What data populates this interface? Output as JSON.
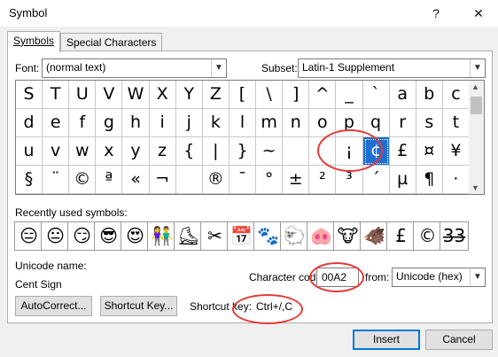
{
  "window": {
    "title": "Symbol",
    "help_label": "?",
    "close_label": "✕"
  },
  "tabs": [
    {
      "label": "Symbols",
      "active": true
    },
    {
      "label": "Special Characters",
      "active": false
    }
  ],
  "font": {
    "label": "Font:",
    "value": "(normal text)"
  },
  "subset": {
    "label": "Subset:",
    "value": "Latin-1 Supplement"
  },
  "symbol_grid": {
    "rows": [
      [
        "S",
        "T",
        "U",
        "V",
        "W",
        "X",
        "Y",
        "Z",
        "[",
        "\\",
        "]",
        "^",
        "_",
        "`",
        "a",
        "b",
        "c"
      ],
      [
        "d",
        "e",
        "f",
        "g",
        "h",
        "i",
        "j",
        "k",
        "l",
        "m",
        "n",
        "o",
        "p",
        "q",
        "r",
        "s",
        "t"
      ],
      [
        "u",
        "v",
        "w",
        "x",
        "y",
        "z",
        "{",
        "|",
        "}",
        "~",
        " ",
        " ",
        "¡",
        "¢",
        "£",
        "¤",
        "¥"
      ],
      [
        "§",
        "¨",
        "©",
        "ª",
        "«",
        "¬",
        "­",
        "®",
        "¯",
        "°",
        "±",
        "²",
        "³",
        "´",
        "µ",
        "¶",
        "·"
      ]
    ],
    "selected": {
      "row": 2,
      "col": 13,
      "char": "¢"
    }
  },
  "recent": {
    "label": "Recently used symbols:",
    "items": [
      "😑",
      "😐",
      "😏",
      "😎",
      "😍",
      "👫",
      "⛸",
      "✂",
      "📅",
      "🐾",
      "🐑",
      "🐽",
      "🐮",
      "🐗",
      "£",
      "©",
      "3̶3̶"
    ]
  },
  "unicode_name": {
    "label": "Unicode name:",
    "value": "Cent Sign"
  },
  "character_code": {
    "label": "Character code:",
    "value": "00A2"
  },
  "from": {
    "label": "from:",
    "value": "Unicode (hex)"
  },
  "buttons": {
    "autocorrect": "AutoCorrect...",
    "shortcut_key": "Shortcut Key...",
    "insert": "Insert",
    "cancel": "Cancel"
  },
  "shortcut": {
    "label": "Shortcut key:",
    "value": "Ctrl+/,C"
  },
  "colors": {
    "selection": "#1e6fd0",
    "annotation": "#e53935",
    "primary_border": "#0078d7"
  }
}
